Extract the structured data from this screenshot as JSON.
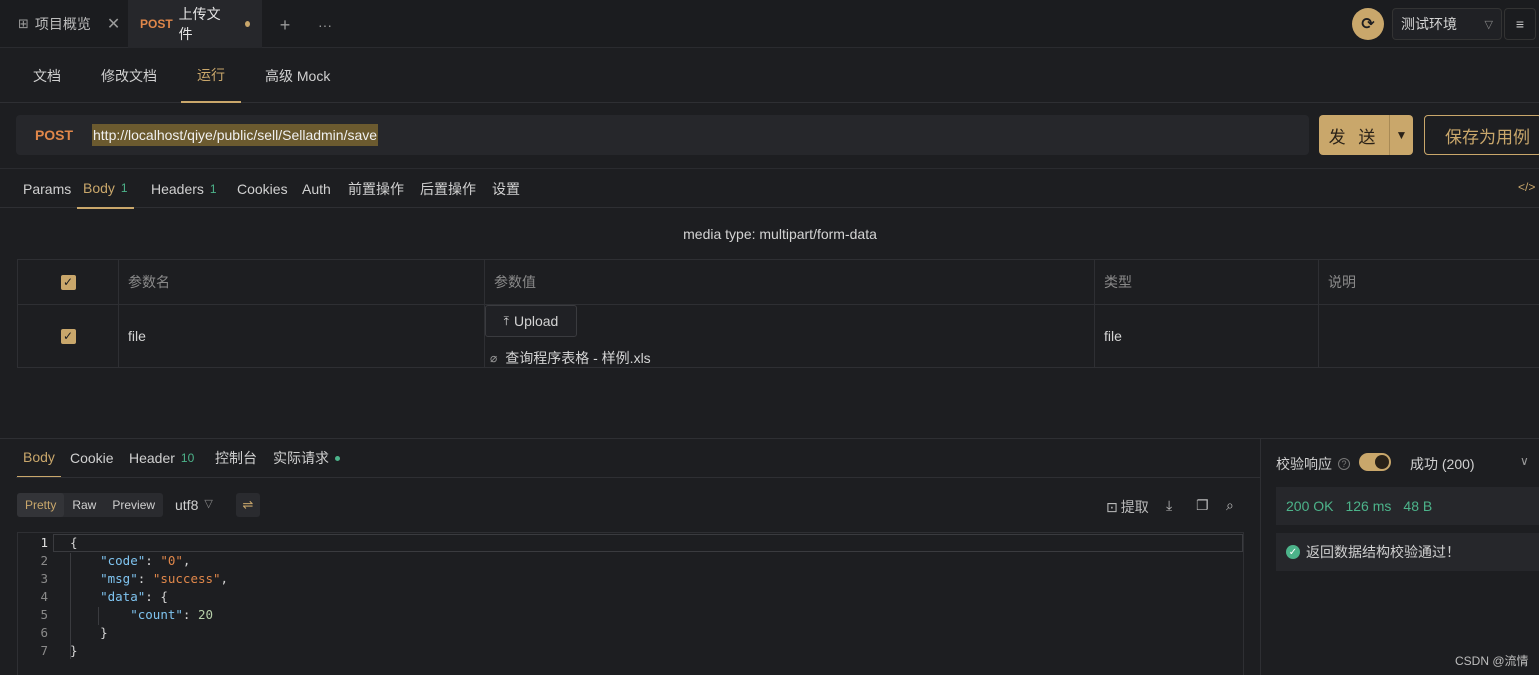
{
  "tabs": [
    {
      "label": "项目概览",
      "icon": "grid-icon"
    },
    {
      "method": "POST",
      "label": "上传文件",
      "modified": true
    }
  ],
  "env": {
    "label": "测试环境"
  },
  "subnav": [
    "文档",
    "修改文档",
    "运行",
    "高级 Mock"
  ],
  "request": {
    "method": "POST",
    "url": "http://localhost/qiye/public/sell/Selladmin/save",
    "send_label": "发 送",
    "save_label": "保存为用例"
  },
  "req_tabs": {
    "params": "Params",
    "body": "Body",
    "body_count": "1",
    "headers": "Headers",
    "headers_count": "1",
    "cookies": "Cookies",
    "auth": "Auth",
    "pre": "前置操作",
    "post": "后置操作",
    "settings": "设置"
  },
  "media_type": "media type: multipart/form-data",
  "params_table": {
    "headers": [
      "参数名",
      "参数值",
      "类型",
      "说明"
    ],
    "rows": [
      {
        "name": "file",
        "upload_label": "Upload",
        "file_name": "查询程序表格 - 样例.xls",
        "type": "file",
        "desc": ""
      }
    ]
  },
  "resp_tabs": {
    "body": "Body",
    "cookie": "Cookie",
    "header": "Header",
    "header_count": "10",
    "console": "控制台",
    "actual": "实际请求"
  },
  "view": {
    "pretty": "Pretty",
    "raw": "Raw",
    "preview": "Preview",
    "encoding": "utf8"
  },
  "toolbar": {
    "extract": "提取"
  },
  "response_lines": [
    "1",
    "2",
    "3",
    "4",
    "5",
    "6",
    "7"
  ],
  "response_json": {
    "code_key": "\"code\"",
    "code_val": "\"0\"",
    "msg_key": "\"msg\"",
    "msg_val": "\"success\"",
    "data_key": "\"data\"",
    "count_key": "\"count\"",
    "count_val": "20"
  },
  "check": {
    "title": "校验响应",
    "status": "成功 (200)",
    "code": "200 OK",
    "time": "126 ms",
    "size": "48 B",
    "message": "返回数据结构校验通过！"
  },
  "watermark": "CSDN @流情",
  "colors": {
    "accent": "#c9a76b",
    "method": "#e0874a",
    "success": "#4cb38a",
    "bg": "#1d1e21"
  }
}
